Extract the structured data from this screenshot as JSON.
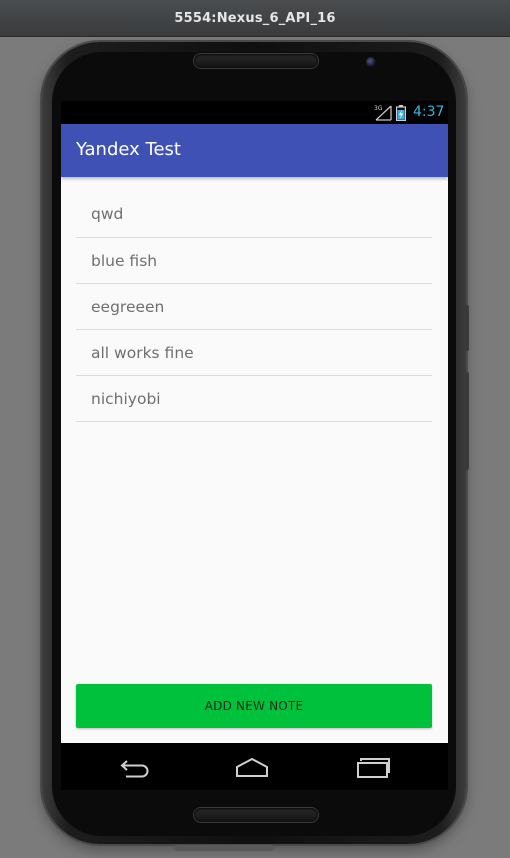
{
  "window": {
    "title": "5554:Nexus_6_API_16"
  },
  "status_bar": {
    "network_type": "3G",
    "time": "4:37",
    "time_color": "#33b5e5"
  },
  "app_bar": {
    "title": "Yandex Test",
    "color": "#3f51b5"
  },
  "notes": [
    {
      "text": "qwd"
    },
    {
      "text": "blue fish"
    },
    {
      "text": "eegreeen"
    },
    {
      "text": "all works fine"
    },
    {
      "text": "nichiyobi"
    }
  ],
  "add_button": {
    "label": "ADD NEW NOTE",
    "color": "#00c13b"
  },
  "nav_bar": {
    "items": [
      {
        "icon": "back-icon"
      },
      {
        "icon": "home-icon"
      },
      {
        "icon": "recents-icon"
      }
    ]
  }
}
